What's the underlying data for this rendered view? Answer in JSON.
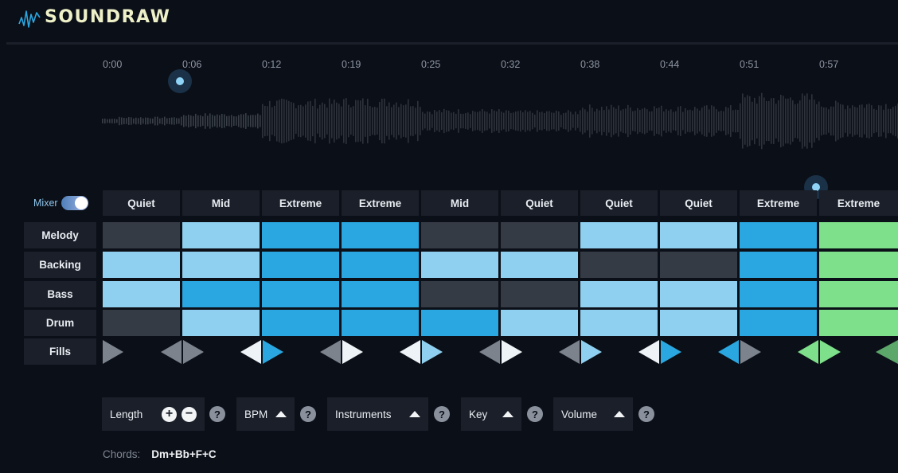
{
  "app": {
    "logo_text": "SOUNDRAW",
    "accent": "#2aa7e0"
  },
  "timeline": {
    "labels": [
      "0:00",
      "0:06",
      "0:12",
      "0:19",
      "0:25",
      "0:32",
      "0:38",
      "0:44",
      "0:51",
      "0:57"
    ]
  },
  "mixer": {
    "label": "Mixer",
    "enabled": true
  },
  "sections": [
    "Quiet",
    "Mid",
    "Extreme",
    "Extreme",
    "Mid",
    "Quiet",
    "Quiet",
    "Quiet",
    "Extreme",
    "Extreme"
  ],
  "tracks": [
    {
      "label": "Melody",
      "levels": [
        "off",
        "low",
        "high",
        "high",
        "off",
        "off",
        "low",
        "low",
        "high",
        "green"
      ]
    },
    {
      "label": "Backing",
      "levels": [
        "low",
        "low",
        "high",
        "high",
        "low",
        "low",
        "off",
        "off",
        "high",
        "green"
      ]
    },
    {
      "label": "Bass",
      "levels": [
        "low",
        "high",
        "high",
        "high",
        "off",
        "off",
        "low",
        "low",
        "high",
        "green"
      ]
    },
    {
      "label": "Drum",
      "levels": [
        "off",
        "low",
        "high",
        "high",
        "high",
        "low",
        "low",
        "low",
        "high",
        "green"
      ]
    }
  ],
  "fills": {
    "label": "Fills",
    "pairs": [
      [
        "gray",
        "gray"
      ],
      [
        "white",
        "blue"
      ],
      [
        "gray",
        "white"
      ],
      [
        "white",
        "light"
      ],
      [
        "gray",
        "white"
      ],
      [
        "gray",
        "light"
      ],
      [
        "white",
        "blue"
      ],
      [
        "blue",
        "gray"
      ],
      [
        "green",
        "green"
      ]
    ],
    "first": "gray"
  },
  "level_colors": {
    "off": "#353b45",
    "low": "#8fd0f0",
    "high": "#2aa7e0",
    "green": "#7ee08a"
  },
  "fill_colors": {
    "gray": "#7c838d",
    "white": "#eef3f8",
    "blue": "#2aa7e0",
    "light": "#8fd0f0",
    "green": "#7ee08a",
    "darkgreen": "#5ba86a"
  },
  "controls": {
    "length": {
      "label": "Length",
      "add_icon": "+",
      "remove_icon": "−"
    },
    "bpm": {
      "label": "BPM"
    },
    "instruments": {
      "label": "Instruments"
    },
    "key": {
      "label": "Key"
    },
    "volume": {
      "label": "Volume"
    },
    "help_glyph": "?"
  },
  "chords": {
    "label": "Chords:",
    "value": "Dm+Bb+F+C"
  }
}
